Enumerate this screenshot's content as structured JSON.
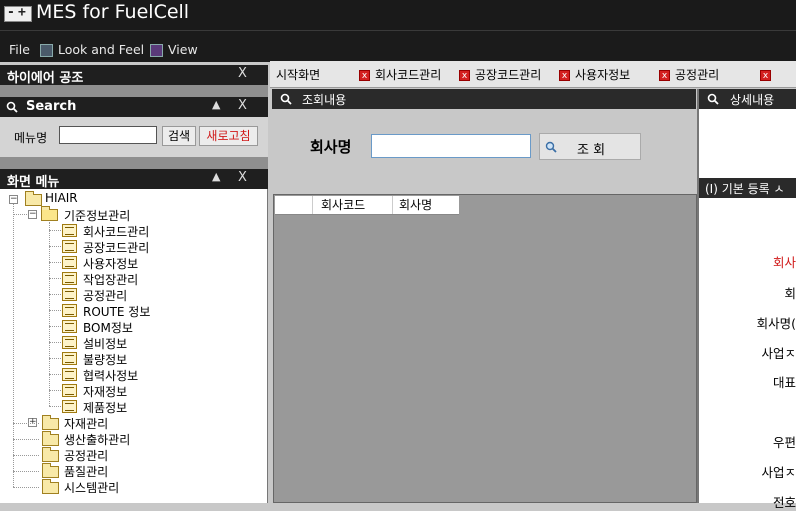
{
  "window": {
    "title": "MES for FuelCell"
  },
  "menubar": {
    "file": "File",
    "look_and_feel": "Look and Feel",
    "view": "View"
  },
  "panels": {
    "company_panel": {
      "title": "하이에어 공조",
      "close": "X"
    },
    "search_panel": {
      "title": "Search",
      "collapse": "▲",
      "close": "X",
      "menu_name_label": "메뉴명",
      "menu_name_value": "",
      "search_button": "검색",
      "refresh_button": "새로고침"
    },
    "menu_panel": {
      "title": "화면 메뉴",
      "collapse": "▲",
      "close": "X"
    }
  },
  "tree": {
    "root": "HIAIR",
    "standard": "기준정보관리",
    "standard_items": [
      "회사코드관리",
      "공장코드관리",
      "사용자정보",
      "작업장관리",
      "공정관리",
      "ROUTE 정보",
      "BOM정보",
      "설비정보",
      "불량정보",
      "협력사정보",
      "자재정보",
      "제품정보"
    ],
    "groups": [
      "자재관리",
      "생산출하관리",
      "공정관리",
      "품질관리",
      "시스템관리"
    ]
  },
  "tabs": [
    "시작화면",
    "회사코드관리",
    "공장코드관리",
    "사용자정보",
    "공정관리"
  ],
  "query": {
    "header": "조회내용",
    "company_label": "회사명",
    "company_value": "",
    "query_button": "조 회",
    "grid_columns": [
      "회사코드",
      "회사명"
    ]
  },
  "detail": {
    "header": "상세내용",
    "reg_header": "(I) 기본 등록 ㅅ",
    "labels": [
      "회사",
      "회",
      "회사명(",
      "사업ㅈ",
      "대표",
      "우편",
      "사업ㅈ",
      "전호"
    ]
  },
  "colors": {
    "refresh_text": "#d01818",
    "required_label": "#d01818"
  },
  "icons": [
    "app-icon",
    "look-and-feel-icon",
    "view-icon",
    "magnifier-icon",
    "folder-icon",
    "document-icon",
    "close-tab-icon"
  ]
}
